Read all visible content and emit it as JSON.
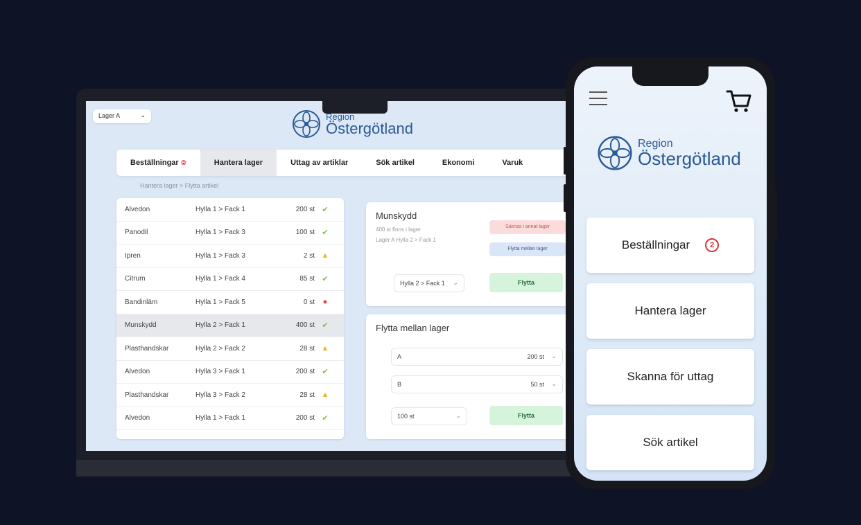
{
  "laptop": {
    "lager_select": "Lager A",
    "logo": {
      "region": "Region",
      "name": "Östergötland"
    },
    "tabs": [
      {
        "label": "Beställningar",
        "badge": "2"
      },
      {
        "label": "Hantera lager"
      },
      {
        "label": "Uttag av artiklar"
      },
      {
        "label": "Sök artikel"
      },
      {
        "label": "Ekonomi"
      },
      {
        "label": "Varuk"
      }
    ],
    "breadcrumb": "Hantera lager > Flytta artikel",
    "table": [
      {
        "name": "Alvedon",
        "location": "Hylla 1 > Fack 1",
        "qty": "200 st",
        "status": "ok"
      },
      {
        "name": "Panodil",
        "location": "Hylla 1 > Fack 3",
        "qty": "100 st",
        "status": "ok"
      },
      {
        "name": "Ipren",
        "location": "Hylla 1 > Fack 3",
        "qty": "2 st",
        "status": "warn"
      },
      {
        "name": "Citrum",
        "location": "Hylla 1 > Fack 4",
        "qty": "85 st",
        "status": "ok"
      },
      {
        "name": "Bandinläm",
        "location": "Hylla 1 > Fack 5",
        "qty": "0 st",
        "status": "error"
      },
      {
        "name": "Munskydd",
        "location": "Hylla 2 > Fack 1",
        "qty": "400 st",
        "status": "ok"
      },
      {
        "name": "Plasthandskar",
        "location": "Hylla 2 > Fack 2",
        "qty": "28 st",
        "status": "warn"
      },
      {
        "name": "Alvedon",
        "location": "Hylla 3 > Fack 1",
        "qty": "200 st",
        "status": "ok"
      },
      {
        "name": "Plasthandskar",
        "location": "Hylla 3 > Fack 2",
        "qty": "28 st",
        "status": "warn"
      },
      {
        "name": "Alvedon",
        "location": "Hylla 1 > Fack 1",
        "qty": "200 st",
        "status": "ok"
      }
    ],
    "card_a": {
      "title": "Munskydd",
      "desc1": "400 st finns i lager",
      "desc2": "Lager A Hylla 2 > Fack 1",
      "pill_red": "Saknas i annat lager",
      "pill_blue": "Flytta mellan lager",
      "select": "Hylla 2 > Fack 1",
      "button": "Flytta"
    },
    "card_b": {
      "title": "Flytta mellan lager",
      "from_value": "A",
      "from_qty": "200 st",
      "to_value": "B",
      "to_qty": "50 st",
      "qty_value": "100 st",
      "button": "Flytta"
    }
  },
  "phone": {
    "logo": {
      "region": "Region",
      "name": "Östergötland"
    },
    "buttons": [
      {
        "label": "Beställningar",
        "badge": "2"
      },
      {
        "label": "Hantera lager"
      },
      {
        "label": "Skanna för uttag"
      },
      {
        "label": "Sök artikel"
      }
    ]
  },
  "colors": {
    "ok": "#7ac142",
    "warn": "#f0b429",
    "error": "#e53935",
    "brand": "#2a5a95"
  },
  "icons": {
    "ok": "check-icon",
    "warn": "warning-icon",
    "error": "error-dot-icon"
  }
}
